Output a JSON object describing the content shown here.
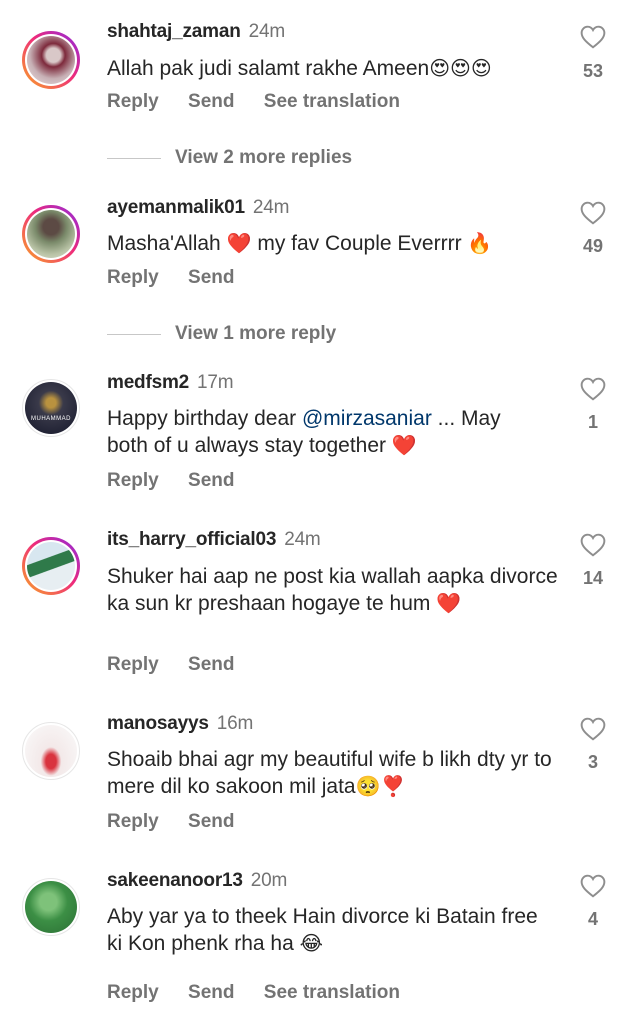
{
  "comments": [
    {
      "username": "shahtaj_zaman",
      "time": "24m",
      "text": "Allah pak judi salamt rakhe Ameen",
      "emoji": "😍😍😍",
      "likes": "53",
      "actions": [
        "Reply",
        "Send",
        "See translation"
      ]
    },
    {
      "username": "ayemanmalik01",
      "time": "24m",
      "text_a": "Masha'Allah",
      "emoji_a": "❤️",
      "text_b": "my fav Couple Everrrr",
      "emoji_b": "🔥",
      "likes": "49",
      "actions": [
        "Reply",
        "Send"
      ]
    },
    {
      "username": "medfsm2",
      "time": "17m",
      "text_a": "Happy birthday dear",
      "mention": "@mirzasaniar",
      "text_b": "... May both of u always stay together",
      "emoji": "❤️",
      "likes": "1",
      "actions": [
        "Reply",
        "Send"
      ]
    },
    {
      "username": "its_harry_official03",
      "time": "24m",
      "text": "Shuker hai aap ne post kia wallah aapka divorce ka sun kr preshaan hogaye te hum",
      "emoji": "❤️",
      "likes": "14",
      "actions": [
        "Reply",
        "Send"
      ]
    },
    {
      "username": "manosayys",
      "time": "16m",
      "text": "Shoaib bhai agr my beautiful wife b likh dty yr to mere dil ko sakoon mil jata",
      "emoji": "🥺❣️",
      "likes": "3",
      "actions": [
        "Reply",
        "Send"
      ]
    },
    {
      "username": "sakeenanoor13",
      "time": "20m",
      "text": "Aby yar ya to theek Hain divorce ki Batain free ki Kon phenk rha ha",
      "emoji": "😂",
      "likes": "4",
      "actions": [
        "Reply",
        "Send",
        "See translation"
      ]
    }
  ],
  "replies": [
    {
      "label": "View 2 more replies"
    },
    {
      "label": "View 1 more reply"
    }
  ],
  "avatar_logo_text": "MUHAMMAD",
  "icons": {
    "like": "heart-outline-icon"
  },
  "colors": {
    "username": "#262626",
    "muted": "#737373",
    "mention": "#00376b",
    "story_ring_start": "#f9a825",
    "story_ring_end": "#8a2be2"
  }
}
